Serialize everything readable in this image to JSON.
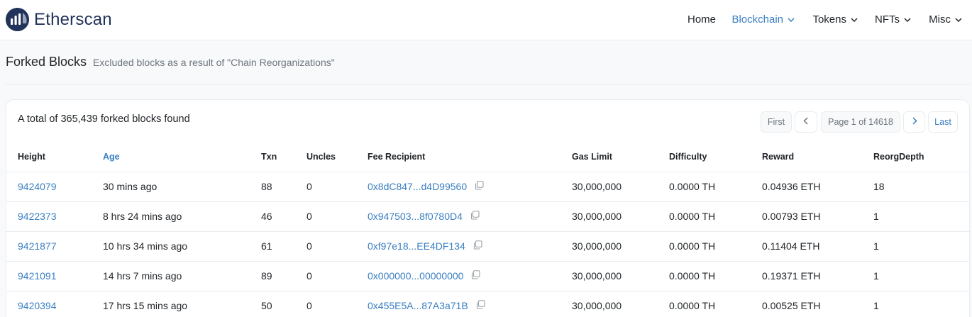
{
  "brand": {
    "name": "Etherscan"
  },
  "nav": [
    {
      "label": "Home",
      "active": false,
      "dropdown": false
    },
    {
      "label": "Blockchain",
      "active": true,
      "dropdown": true
    },
    {
      "label": "Tokens",
      "active": false,
      "dropdown": true
    },
    {
      "label": "NFTs",
      "active": false,
      "dropdown": true
    },
    {
      "label": "Misc",
      "active": false,
      "dropdown": true
    }
  ],
  "page": {
    "title": "Forked Blocks",
    "subtitle": "Excluded blocks as a result of \"Chain Reorganizations\""
  },
  "summary": {
    "total_text": "A total of 365,439 forked blocks found"
  },
  "pagination": {
    "first": "First",
    "prev_icon": "chevron-left-icon",
    "page_text": "Page 1 of 14618",
    "next_icon": "chevron-right-icon",
    "last": "Last"
  },
  "table": {
    "columns": [
      "Height",
      "Age",
      "Txn",
      "Uncles",
      "Fee Recipient",
      "Gas Limit",
      "Difficulty",
      "Reward",
      "ReorgDepth"
    ],
    "rows": [
      {
        "height": "9424079",
        "age": "30 mins ago",
        "txn": "88",
        "uncles": "0",
        "fee_recipient": "0x8dC847...d4D99560",
        "gas_limit": "30,000,000",
        "difficulty": "0.0000 TH",
        "reward": "0.04936 ETH",
        "reorg_depth": "18"
      },
      {
        "height": "9422373",
        "age": "8 hrs 24 mins ago",
        "txn": "46",
        "uncles": "0",
        "fee_recipient": "0x947503...8f0780D4",
        "gas_limit": "30,000,000",
        "difficulty": "0.0000 TH",
        "reward": "0.00793 ETH",
        "reorg_depth": "1"
      },
      {
        "height": "9421877",
        "age": "10 hrs 34 mins ago",
        "txn": "61",
        "uncles": "0",
        "fee_recipient": "0xf97e18...EE4DF134",
        "gas_limit": "30,000,000",
        "difficulty": "0.0000 TH",
        "reward": "0.11404 ETH",
        "reorg_depth": "1"
      },
      {
        "height": "9421091",
        "age": "14 hrs 7 mins ago",
        "txn": "89",
        "uncles": "0",
        "fee_recipient": "0x000000...00000000",
        "gas_limit": "30,000,000",
        "difficulty": "0.0000 TH",
        "reward": "0.19371 ETH",
        "reorg_depth": "1"
      },
      {
        "height": "9420394",
        "age": "17 hrs 15 mins ago",
        "txn": "50",
        "uncles": "0",
        "fee_recipient": "0x455E5A...87A3a71B",
        "gas_limit": "30,000,000",
        "difficulty": "0.0000 TH",
        "reward": "0.00525 ETH",
        "reorg_depth": "1"
      }
    ]
  },
  "icons": {
    "copy": "copy-icon",
    "logo": "etherscan-logo-icon"
  },
  "colors": {
    "brand": "#21325b",
    "link": "#3a7fc2",
    "muted": "#6c757d",
    "border": "#e9ecef"
  }
}
